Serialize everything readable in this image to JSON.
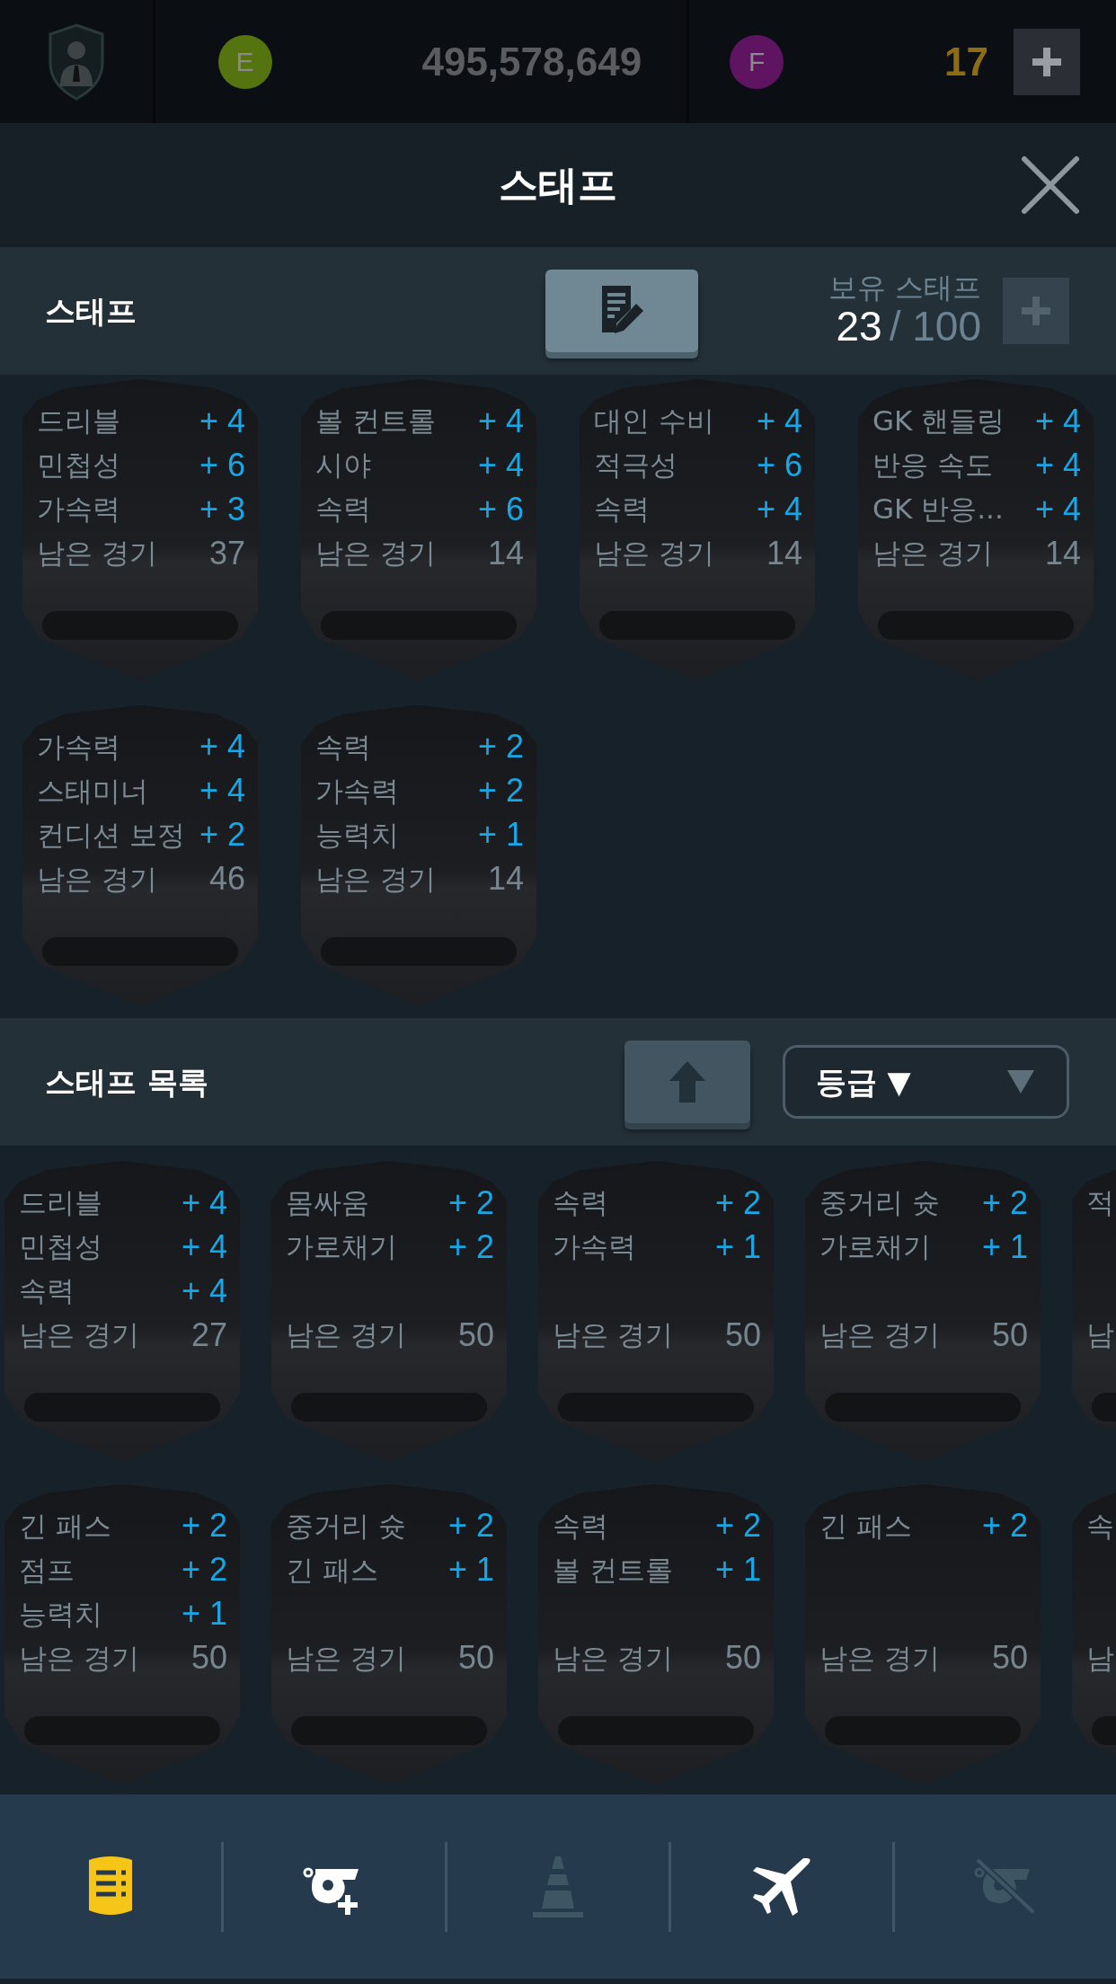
{
  "top_bar": {
    "currencies": [
      {
        "letter": "E",
        "color": "#55730f",
        "amount": "495,578,649"
      },
      {
        "letter": "F",
        "color": "#5e1460",
        "amount": "17"
      }
    ]
  },
  "title": "스태프",
  "staff_section": {
    "title": "스태프",
    "owned_label": "보유 스태프",
    "owned_count": "23",
    "capacity": "/ 100"
  },
  "equipped_staff": [
    {
      "stats": [
        {
          "name": "드리블",
          "value": "+ 4"
        },
        {
          "name": "민첩성",
          "value": "+ 6"
        },
        {
          "name": "가속력",
          "value": "+ 3"
        }
      ],
      "remaining_label": "남은 경기",
      "remaining": "37"
    },
    {
      "stats": [
        {
          "name": "볼 컨트롤",
          "value": "+ 4"
        },
        {
          "name": "시야",
          "value": "+ 4"
        },
        {
          "name": "속력",
          "value": "+ 6"
        }
      ],
      "remaining_label": "남은 경기",
      "remaining": "14"
    },
    {
      "stats": [
        {
          "name": "대인 수비",
          "value": "+ 4"
        },
        {
          "name": "적극성",
          "value": "+ 6"
        },
        {
          "name": "속력",
          "value": "+ 4"
        }
      ],
      "remaining_label": "남은 경기",
      "remaining": "14"
    },
    {
      "stats": [
        {
          "name": "GK 핸들링",
          "value": "+ 4"
        },
        {
          "name": "반응 속도",
          "value": "+ 4"
        },
        {
          "name": "GK 반응...",
          "value": "+ 4"
        }
      ],
      "remaining_label": "남은 경기",
      "remaining": "14"
    },
    {
      "stats": [
        {
          "name": "가속력",
          "value": "+ 4"
        },
        {
          "name": "스태미너",
          "value": "+ 4"
        },
        {
          "name": "컨디션 보정",
          "value": "+ 2"
        }
      ],
      "remaining_label": "남은 경기",
      "remaining": "46"
    },
    {
      "stats": [
        {
          "name": "속력",
          "value": "+ 2"
        },
        {
          "name": "가속력",
          "value": "+ 2"
        },
        {
          "name": "능력치",
          "value": "+ 1"
        }
      ],
      "remaining_label": "남은 경기",
      "remaining": "14"
    }
  ],
  "list_section": {
    "title": "스태프 목록",
    "sort": "등급 ▼"
  },
  "staff_list": [
    {
      "stats": [
        {
          "name": "드리블",
          "value": "+ 4"
        },
        {
          "name": "민첩성",
          "value": "+ 4"
        },
        {
          "name": "속력",
          "value": "+ 4"
        }
      ],
      "remaining_label": "남은 경기",
      "remaining": "27"
    },
    {
      "stats": [
        {
          "name": "몸싸움",
          "value": "+ 2"
        },
        {
          "name": "가로채기",
          "value": "+ 2"
        }
      ],
      "remaining_label": "남은 경기",
      "remaining": "50"
    },
    {
      "stats": [
        {
          "name": "속력",
          "value": "+ 2"
        },
        {
          "name": "가속력",
          "value": "+ 1"
        }
      ],
      "remaining_label": "남은 경기",
      "remaining": "50"
    },
    {
      "stats": [
        {
          "name": "중거리 슛",
          "value": "+ 2"
        },
        {
          "name": "가로채기",
          "value": "+ 1"
        }
      ],
      "remaining_label": "남은 경기",
      "remaining": "50"
    },
    {
      "stats": [
        {
          "name": "적"
        }
      ],
      "remaining_label": "남"
    },
    {
      "stats": [
        {
          "name": "긴 패스",
          "value": "+ 2"
        },
        {
          "name": "점프",
          "value": "+ 2"
        },
        {
          "name": "능력치",
          "value": "+ 1"
        }
      ],
      "remaining_label": "남은 경기",
      "remaining": "50"
    },
    {
      "stats": [
        {
          "name": "중거리 슛",
          "value": "+ 2"
        },
        {
          "name": "긴 패스",
          "value": "+ 1"
        }
      ],
      "remaining_label": "남은 경기",
      "remaining": "50"
    },
    {
      "stats": [
        {
          "name": "속력",
          "value": "+ 2"
        },
        {
          "name": "볼 컨트롤",
          "value": "+ 1"
        }
      ],
      "remaining_label": "남은 경기",
      "remaining": "50"
    },
    {
      "stats": [
        {
          "name": "긴 패스",
          "value": "+ 2"
        }
      ],
      "remaining_label": "남은 경기",
      "remaining": "50"
    },
    {
      "stats": [
        {
          "name": "속"
        }
      ],
      "remaining_label": "남"
    }
  ],
  "bottom_nav": [
    {
      "selected": true,
      "disabled": false
    },
    {
      "selected": false,
      "disabled": false
    },
    {
      "selected": false,
      "disabled": true
    },
    {
      "selected": false,
      "disabled": false
    },
    {
      "selected": false,
      "disabled": true
    }
  ]
}
